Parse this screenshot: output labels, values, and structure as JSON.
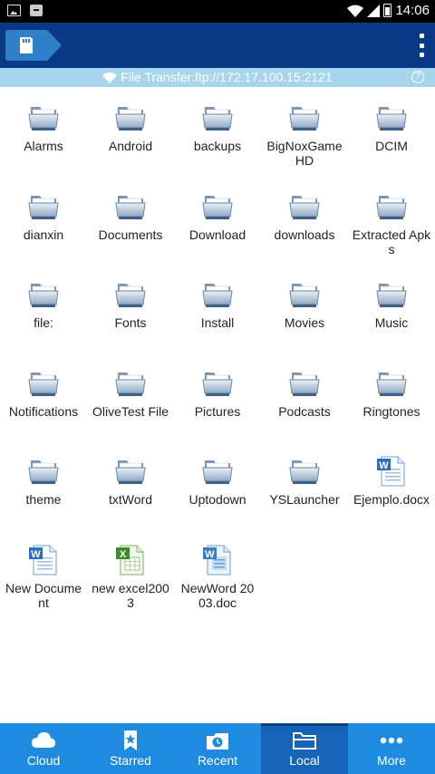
{
  "status_bar": {
    "time": "14:06"
  },
  "toolbar": {
    "location_icon": "sd-card-icon",
    "menu_icon": "overflow-menu-icon"
  },
  "ftp_banner": {
    "text": "File Transfer:ftp://172.17.100.15:2121"
  },
  "files": [
    {
      "name": "Alarms",
      "type": "folder"
    },
    {
      "name": "Android",
      "type": "folder"
    },
    {
      "name": "backups",
      "type": "folder"
    },
    {
      "name": "BigNoxGameHD",
      "type": "folder"
    },
    {
      "name": "DCIM",
      "type": "folder"
    },
    {
      "name": "dianxin",
      "type": "folder"
    },
    {
      "name": "Documents",
      "type": "folder"
    },
    {
      "name": "Download",
      "type": "folder"
    },
    {
      "name": "downloads",
      "type": "folder"
    },
    {
      "name": "Extracted Apks",
      "type": "folder"
    },
    {
      "name": "file:",
      "type": "folder"
    },
    {
      "name": "Fonts",
      "type": "folder"
    },
    {
      "name": "Install",
      "type": "folder"
    },
    {
      "name": "Movies",
      "type": "folder"
    },
    {
      "name": "Music",
      "type": "folder"
    },
    {
      "name": "Notifications",
      "type": "folder"
    },
    {
      "name": "OliveTest File",
      "type": "folder"
    },
    {
      "name": "Pictures",
      "type": "folder"
    },
    {
      "name": "Podcasts",
      "type": "folder"
    },
    {
      "name": "Ringtones",
      "type": "folder"
    },
    {
      "name": "theme",
      "type": "folder"
    },
    {
      "name": "txtWord",
      "type": "folder"
    },
    {
      "name": "Uptodown",
      "type": "folder"
    },
    {
      "name": "YSLauncher",
      "type": "folder"
    },
    {
      "name": "Ejemplo.docx",
      "type": "word"
    },
    {
      "name": "New Document",
      "type": "word"
    },
    {
      "name": "new excel2003",
      "type": "excel"
    },
    {
      "name": "NewWord 2003.doc",
      "type": "word-old"
    }
  ],
  "bottom_nav": [
    {
      "label": "Cloud",
      "icon": "cloud-icon",
      "active": false
    },
    {
      "label": "Starred",
      "icon": "starred-icon",
      "active": false
    },
    {
      "label": "Recent",
      "icon": "recent-icon",
      "active": false
    },
    {
      "label": "Local",
      "icon": "local-folder-icon",
      "active": true
    },
    {
      "label": "More",
      "icon": "more-icon",
      "active": false
    }
  ],
  "colors": {
    "toolbar": "#0a3a86",
    "ftp_banner": "#a6d5ec",
    "bottom_nav": "#1e8be0",
    "bottom_nav_active": "#1664b8"
  }
}
